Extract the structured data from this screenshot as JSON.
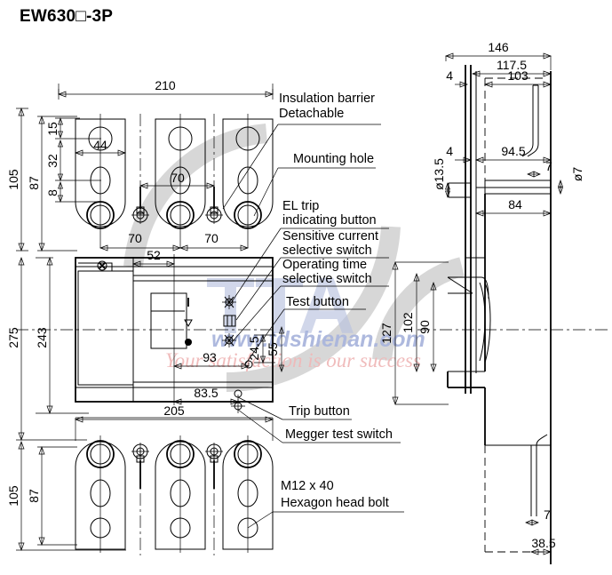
{
  "title": "EW630□-3P",
  "watermark": {
    "logo": "TTA",
    "url": "www.tdshienan.com",
    "slogan": "Your satisfaction is our success"
  },
  "front_view": {
    "name": "front-view",
    "dimensions": {
      "overall_width": "210",
      "pole_pitch_top_left": "70",
      "pole_pitch_top_right": "70",
      "pole_pitch_mid": "70",
      "terminal_width": "44",
      "terminal_height_outer": "105",
      "terminal_height_inner": "87",
      "hole_1": "15",
      "hole_2": "32",
      "hole_3": "8",
      "body_height_outer": "275",
      "body_height_inner": "243",
      "cover_width": "52",
      "handle_offset": "93",
      "switch_offset": "83.5",
      "body_width": "205",
      "switch_v_small": "24.5",
      "switch_v_large": "55",
      "bottom_height_outer": "105",
      "bottom_height_inner": "87",
      "bottom_width": "205"
    }
  },
  "side_view": {
    "name": "side-view",
    "dimensions": {
      "overall_depth": "146",
      "depth_2": "117.5",
      "depth_3": "103",
      "front_plate_1": "4",
      "front_plate_2": "4",
      "inner_depth": "94.5",
      "terminal_thickness_top": "7",
      "mount_hole_dia": "ø13.5",
      "terminal_hole_dia": "ø7",
      "terminal_len": "84",
      "height_127": "127",
      "height_102": "102",
      "height_90": "90",
      "terminal_thickness_bottom": "7",
      "bottom_depth": "38.5"
    }
  },
  "callouts": [
    {
      "id": "insulation-barrier",
      "line1": "Insulation barrier",
      "line2": "Detachable"
    },
    {
      "id": "mounting-hole",
      "line1": "Mounting hole",
      "line2": ""
    },
    {
      "id": "el-trip-indicating-button",
      "line1": "EL trip",
      "line2": "indicating button"
    },
    {
      "id": "sensitive-current-selective-switch",
      "line1": "Sensitive current",
      "line2": "selective switch"
    },
    {
      "id": "operating-time-selective-switch",
      "line1": "Operating time",
      "line2": "selective switch"
    },
    {
      "id": "test-button",
      "line1": "Test button",
      "line2": ""
    },
    {
      "id": "trip-button",
      "line1": "Trip button",
      "line2": ""
    },
    {
      "id": "megger-test-switch",
      "line1": "Megger test switch",
      "line2": ""
    },
    {
      "id": "hexagon-head-bolt",
      "line1": "M12 x 40",
      "line2": "Hexagon head bolt"
    }
  ]
}
